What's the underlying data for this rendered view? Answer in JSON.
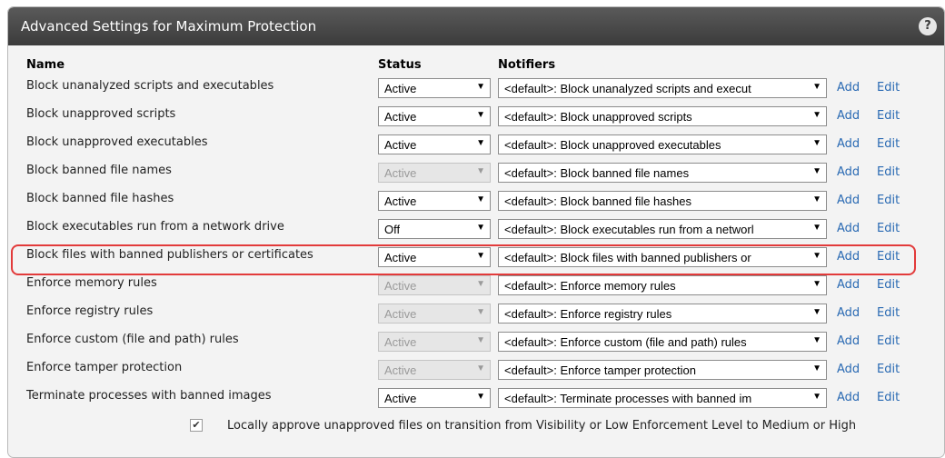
{
  "header": {
    "title": "Advanced Settings for Maximum Protection",
    "help_label": "?"
  },
  "columns": {
    "name": "Name",
    "status": "Status",
    "notifiers": "Notifiers"
  },
  "link_labels": {
    "add": "Add",
    "edit": "Edit"
  },
  "rows": [
    {
      "name": "Block unanalyzed scripts and executables",
      "status": "Active",
      "status_disabled": false,
      "notifier": "<default>: Block unanalyzed scripts and execut"
    },
    {
      "name": "Block unapproved scripts",
      "status": "Active",
      "status_disabled": false,
      "notifier": "<default>: Block unapproved scripts"
    },
    {
      "name": "Block unapproved executables",
      "status": "Active",
      "status_disabled": false,
      "notifier": "<default>: Block unapproved executables"
    },
    {
      "name": "Block banned file names",
      "status": "Active",
      "status_disabled": true,
      "notifier": "<default>: Block banned file names"
    },
    {
      "name": "Block banned file hashes",
      "status": "Active",
      "status_disabled": false,
      "notifier": "<default>: Block banned file hashes"
    },
    {
      "name": "Block executables run from a network drive",
      "status": "Off",
      "status_disabled": false,
      "notifier": "<default>: Block executables run from a networl"
    },
    {
      "name": "Block files with banned publishers or certificates",
      "status": "Active",
      "status_disabled": false,
      "notifier": "<default>: Block files with banned publishers or"
    },
    {
      "name": "Enforce memory rules",
      "status": "Active",
      "status_disabled": true,
      "notifier": "<default>: Enforce memory rules"
    },
    {
      "name": "Enforce registry rules",
      "status": "Active",
      "status_disabled": true,
      "notifier": "<default>: Enforce registry rules"
    },
    {
      "name": "Enforce custom (file and path) rules",
      "status": "Active",
      "status_disabled": true,
      "notifier": "<default>: Enforce custom (file and path) rules"
    },
    {
      "name": "Enforce tamper protection",
      "status": "Active",
      "status_disabled": true,
      "notifier": "<default>: Enforce tamper protection"
    },
    {
      "name": "Terminate processes with banned images",
      "status": "Active",
      "status_disabled": false,
      "notifier": "<default>: Terminate processes with banned im"
    }
  ],
  "footer": {
    "checked": true,
    "check_glyph": "✔",
    "label": "Locally approve unapproved files on transition from Visibility or Low Enforcement Level to Medium or High"
  },
  "colors": {
    "link": "#2a6ab3",
    "highlight": "#e23a3a",
    "header_bg": "#404040"
  }
}
